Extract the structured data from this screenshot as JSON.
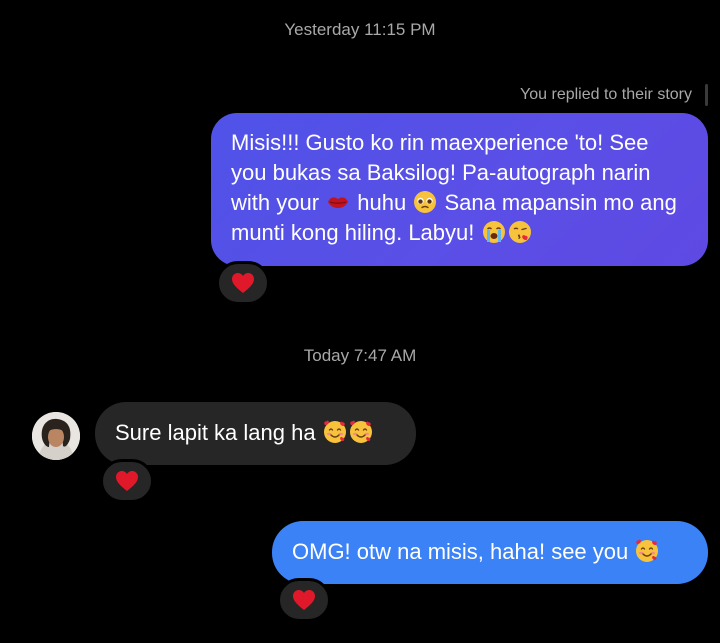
{
  "thread": {
    "timestamp_1": "Yesterday 11:15 PM",
    "story_note": "You replied to their story",
    "timestamp_2": "Today 7:47 AM"
  },
  "messages": [
    {
      "sender": "me",
      "parts": {
        "a": "Misis!!! Gusto ko rin maexperience 'to! See you bukas sa Baksilog! Pa-autograph narin with your ",
        "b": " huhu ",
        "c": " Sana mapansin mo ang munti kong hiling. Labyu! "
      },
      "emojis": [
        "kiss-mark-icon",
        "pleading-face-icon",
        "crying-face-icon",
        "face-blowing-kiss-icon"
      ],
      "reaction": "heart-icon"
    },
    {
      "sender": "them",
      "text": "Sure lapit ka lang ha ",
      "emojis": [
        "smiling-face-with-hearts-icon",
        "smiling-face-with-hearts-icon"
      ],
      "reaction": "heart-icon"
    },
    {
      "sender": "me",
      "text": "OMG! otw na misis, haha! see you ",
      "emojis": [
        "smiling-face-with-hearts-icon"
      ],
      "reaction": "heart-icon"
    }
  ],
  "colors": {
    "background": "#000000",
    "outgoing_gradient": "#5a4fe6",
    "outgoing_blue": "#3b82f6",
    "incoming": "#262626",
    "heart": "#e0192a",
    "timestamp": "#a8a8a8"
  }
}
